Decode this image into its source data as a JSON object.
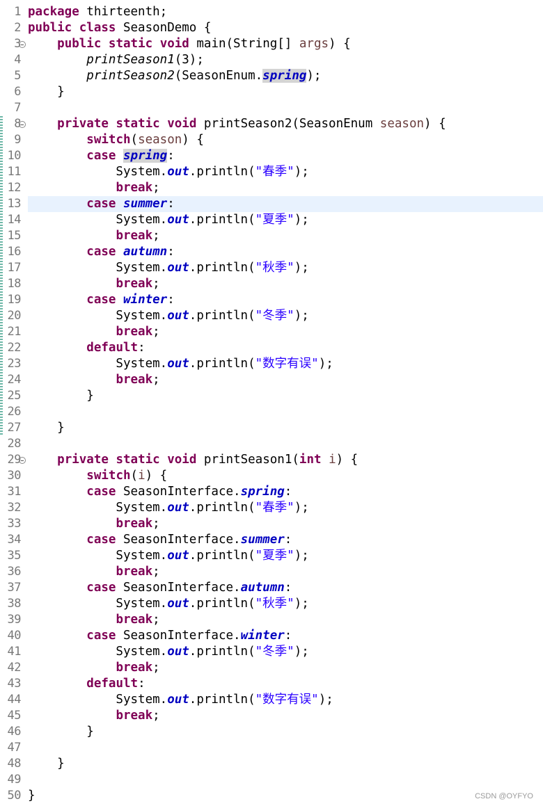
{
  "editor": {
    "current_line": 13,
    "fold_markers": [
      3,
      8,
      29
    ],
    "changed_line_ranges": [
      [
        8,
        27
      ]
    ],
    "colors": {
      "keyword": "#7f0055",
      "string": "#2a00ff",
      "field": "#0000c0",
      "local_variable": "#6a3e3e",
      "current_line_bg": "#e8f2fe",
      "occurrence_highlight": "#d4d4d4"
    },
    "lines": [
      {
        "n": "1",
        "tokens": [
          {
            "t": "package",
            "c": "kw"
          },
          {
            "t": " thirteenth;",
            "c": "plain"
          }
        ]
      },
      {
        "n": "2",
        "tokens": [
          {
            "t": "public",
            "c": "kw"
          },
          {
            "t": " ",
            "c": "plain"
          },
          {
            "t": "class",
            "c": "kw"
          },
          {
            "t": " SeasonDemo {",
            "c": "plain"
          }
        ]
      },
      {
        "n": "3",
        "tokens": [
          {
            "t": "    ",
            "c": "plain"
          },
          {
            "t": "public",
            "c": "kw"
          },
          {
            "t": " ",
            "c": "plain"
          },
          {
            "t": "static",
            "c": "kw"
          },
          {
            "t": " ",
            "c": "plain"
          },
          {
            "t": "void",
            "c": "kw"
          },
          {
            "t": " main(String[] ",
            "c": "plain"
          },
          {
            "t": "args",
            "c": "var"
          },
          {
            "t": ") {",
            "c": "plain"
          }
        ]
      },
      {
        "n": "4",
        "tokens": [
          {
            "t": "        ",
            "c": "plain"
          },
          {
            "t": "printSeason1",
            "c": "mcall"
          },
          {
            "t": "(3);",
            "c": "plain"
          }
        ]
      },
      {
        "n": "5",
        "tokens": [
          {
            "t": "        ",
            "c": "plain"
          },
          {
            "t": "printSeason2",
            "c": "mcall"
          },
          {
            "t": "(SeasonEnum.",
            "c": "plain"
          },
          {
            "t": "spring",
            "c": "fld hl"
          },
          {
            "t": ");",
            "c": "plain"
          }
        ]
      },
      {
        "n": "6",
        "tokens": [
          {
            "t": "    }",
            "c": "plain"
          }
        ]
      },
      {
        "n": "7",
        "tokens": []
      },
      {
        "n": "8",
        "tokens": [
          {
            "t": "    ",
            "c": "plain"
          },
          {
            "t": "private",
            "c": "kw"
          },
          {
            "t": " ",
            "c": "plain"
          },
          {
            "t": "static",
            "c": "kw"
          },
          {
            "t": " ",
            "c": "plain"
          },
          {
            "t": "void",
            "c": "kw"
          },
          {
            "t": " printSeason2(SeasonEnum ",
            "c": "plain"
          },
          {
            "t": "season",
            "c": "var"
          },
          {
            "t": ") {",
            "c": "plain"
          }
        ]
      },
      {
        "n": "9",
        "tokens": [
          {
            "t": "        ",
            "c": "plain"
          },
          {
            "t": "switch",
            "c": "kw"
          },
          {
            "t": "(",
            "c": "plain"
          },
          {
            "t": "season",
            "c": "var"
          },
          {
            "t": ") {",
            "c": "plain"
          }
        ]
      },
      {
        "n": "10",
        "tokens": [
          {
            "t": "        ",
            "c": "plain"
          },
          {
            "t": "case",
            "c": "kw"
          },
          {
            "t": " ",
            "c": "plain"
          },
          {
            "t": "spring",
            "c": "fld hl"
          },
          {
            "t": ":",
            "c": "plain"
          }
        ]
      },
      {
        "n": "11",
        "tokens": [
          {
            "t": "            System.",
            "c": "plain"
          },
          {
            "t": "out",
            "c": "fld"
          },
          {
            "t": ".println(",
            "c": "plain"
          },
          {
            "t": "\"春季\"",
            "c": "str"
          },
          {
            "t": ");",
            "c": "plain"
          }
        ]
      },
      {
        "n": "12",
        "tokens": [
          {
            "t": "            ",
            "c": "plain"
          },
          {
            "t": "break",
            "c": "kw"
          },
          {
            "t": ";",
            "c": "plain"
          }
        ]
      },
      {
        "n": "13",
        "tokens": [
          {
            "t": "        ",
            "c": "plain"
          },
          {
            "t": "case",
            "c": "kw"
          },
          {
            "t": " ",
            "c": "plain"
          },
          {
            "t": "summer",
            "c": "fld"
          },
          {
            "t": ":",
            "c": "plain"
          }
        ]
      },
      {
        "n": "14",
        "tokens": [
          {
            "t": "            System.",
            "c": "plain"
          },
          {
            "t": "out",
            "c": "fld"
          },
          {
            "t": ".println(",
            "c": "plain"
          },
          {
            "t": "\"夏季\"",
            "c": "str"
          },
          {
            "t": ");",
            "c": "plain"
          }
        ]
      },
      {
        "n": "15",
        "tokens": [
          {
            "t": "            ",
            "c": "plain"
          },
          {
            "t": "break",
            "c": "kw"
          },
          {
            "t": ";",
            "c": "plain"
          }
        ]
      },
      {
        "n": "16",
        "tokens": [
          {
            "t": "        ",
            "c": "plain"
          },
          {
            "t": "case",
            "c": "kw"
          },
          {
            "t": " ",
            "c": "plain"
          },
          {
            "t": "autumn",
            "c": "fld"
          },
          {
            "t": ":",
            "c": "plain"
          }
        ]
      },
      {
        "n": "17",
        "tokens": [
          {
            "t": "            System.",
            "c": "plain"
          },
          {
            "t": "out",
            "c": "fld"
          },
          {
            "t": ".println(",
            "c": "plain"
          },
          {
            "t": "\"秋季\"",
            "c": "str"
          },
          {
            "t": ");",
            "c": "plain"
          }
        ]
      },
      {
        "n": "18",
        "tokens": [
          {
            "t": "            ",
            "c": "plain"
          },
          {
            "t": "break",
            "c": "kw"
          },
          {
            "t": ";",
            "c": "plain"
          }
        ]
      },
      {
        "n": "19",
        "tokens": [
          {
            "t": "        ",
            "c": "plain"
          },
          {
            "t": "case",
            "c": "kw"
          },
          {
            "t": " ",
            "c": "plain"
          },
          {
            "t": "winter",
            "c": "fld"
          },
          {
            "t": ":",
            "c": "plain"
          }
        ]
      },
      {
        "n": "20",
        "tokens": [
          {
            "t": "            System.",
            "c": "plain"
          },
          {
            "t": "out",
            "c": "fld"
          },
          {
            "t": ".println(",
            "c": "plain"
          },
          {
            "t": "\"冬季\"",
            "c": "str"
          },
          {
            "t": ");",
            "c": "plain"
          }
        ]
      },
      {
        "n": "21",
        "tokens": [
          {
            "t": "            ",
            "c": "plain"
          },
          {
            "t": "break",
            "c": "kw"
          },
          {
            "t": ";",
            "c": "plain"
          }
        ]
      },
      {
        "n": "22",
        "tokens": [
          {
            "t": "        ",
            "c": "plain"
          },
          {
            "t": "default",
            "c": "kw"
          },
          {
            "t": ":",
            "c": "plain"
          }
        ]
      },
      {
        "n": "23",
        "tokens": [
          {
            "t": "            System.",
            "c": "plain"
          },
          {
            "t": "out",
            "c": "fld"
          },
          {
            "t": ".println(",
            "c": "plain"
          },
          {
            "t": "\"数字有误\"",
            "c": "str"
          },
          {
            "t": ");",
            "c": "plain"
          }
        ]
      },
      {
        "n": "24",
        "tokens": [
          {
            "t": "            ",
            "c": "plain"
          },
          {
            "t": "break",
            "c": "kw"
          },
          {
            "t": ";",
            "c": "plain"
          }
        ]
      },
      {
        "n": "25",
        "tokens": [
          {
            "t": "        }",
            "c": "plain"
          }
        ]
      },
      {
        "n": "26",
        "tokens": []
      },
      {
        "n": "27",
        "tokens": [
          {
            "t": "    }",
            "c": "plain"
          }
        ]
      },
      {
        "n": "28",
        "tokens": []
      },
      {
        "n": "29",
        "tokens": [
          {
            "t": "    ",
            "c": "plain"
          },
          {
            "t": "private",
            "c": "kw"
          },
          {
            "t": " ",
            "c": "plain"
          },
          {
            "t": "static",
            "c": "kw"
          },
          {
            "t": " ",
            "c": "plain"
          },
          {
            "t": "void",
            "c": "kw"
          },
          {
            "t": " printSeason1(",
            "c": "plain"
          },
          {
            "t": "int",
            "c": "kw"
          },
          {
            "t": " ",
            "c": "plain"
          },
          {
            "t": "i",
            "c": "var"
          },
          {
            "t": ") {",
            "c": "plain"
          }
        ]
      },
      {
        "n": "30",
        "tokens": [
          {
            "t": "        ",
            "c": "plain"
          },
          {
            "t": "switch",
            "c": "kw"
          },
          {
            "t": "(",
            "c": "plain"
          },
          {
            "t": "i",
            "c": "var"
          },
          {
            "t": ") {",
            "c": "plain"
          }
        ]
      },
      {
        "n": "31",
        "tokens": [
          {
            "t": "        ",
            "c": "plain"
          },
          {
            "t": "case",
            "c": "kw"
          },
          {
            "t": " SeasonInterface.",
            "c": "plain"
          },
          {
            "t": "spring",
            "c": "fld"
          },
          {
            "t": ":",
            "c": "plain"
          }
        ]
      },
      {
        "n": "32",
        "tokens": [
          {
            "t": "            System.",
            "c": "plain"
          },
          {
            "t": "out",
            "c": "fld"
          },
          {
            "t": ".println(",
            "c": "plain"
          },
          {
            "t": "\"春季\"",
            "c": "str"
          },
          {
            "t": ");",
            "c": "plain"
          }
        ]
      },
      {
        "n": "33",
        "tokens": [
          {
            "t": "            ",
            "c": "plain"
          },
          {
            "t": "break",
            "c": "kw"
          },
          {
            "t": ";",
            "c": "plain"
          }
        ]
      },
      {
        "n": "34",
        "tokens": [
          {
            "t": "        ",
            "c": "plain"
          },
          {
            "t": "case",
            "c": "kw"
          },
          {
            "t": " SeasonInterface.",
            "c": "plain"
          },
          {
            "t": "summer",
            "c": "fld"
          },
          {
            "t": ":",
            "c": "plain"
          }
        ]
      },
      {
        "n": "35",
        "tokens": [
          {
            "t": "            System.",
            "c": "plain"
          },
          {
            "t": "out",
            "c": "fld"
          },
          {
            "t": ".println(",
            "c": "plain"
          },
          {
            "t": "\"夏季\"",
            "c": "str"
          },
          {
            "t": ");",
            "c": "plain"
          }
        ]
      },
      {
        "n": "36",
        "tokens": [
          {
            "t": "            ",
            "c": "plain"
          },
          {
            "t": "break",
            "c": "kw"
          },
          {
            "t": ";",
            "c": "plain"
          }
        ]
      },
      {
        "n": "37",
        "tokens": [
          {
            "t": "        ",
            "c": "plain"
          },
          {
            "t": "case",
            "c": "kw"
          },
          {
            "t": " SeasonInterface.",
            "c": "plain"
          },
          {
            "t": "autumn",
            "c": "fld"
          },
          {
            "t": ":",
            "c": "plain"
          }
        ]
      },
      {
        "n": "38",
        "tokens": [
          {
            "t": "            System.",
            "c": "plain"
          },
          {
            "t": "out",
            "c": "fld"
          },
          {
            "t": ".println(",
            "c": "plain"
          },
          {
            "t": "\"秋季\"",
            "c": "str"
          },
          {
            "t": ");",
            "c": "plain"
          }
        ]
      },
      {
        "n": "39",
        "tokens": [
          {
            "t": "            ",
            "c": "plain"
          },
          {
            "t": "break",
            "c": "kw"
          },
          {
            "t": ";",
            "c": "plain"
          }
        ]
      },
      {
        "n": "40",
        "tokens": [
          {
            "t": "        ",
            "c": "plain"
          },
          {
            "t": "case",
            "c": "kw"
          },
          {
            "t": " SeasonInterface.",
            "c": "plain"
          },
          {
            "t": "winter",
            "c": "fld"
          },
          {
            "t": ":",
            "c": "plain"
          }
        ]
      },
      {
        "n": "41",
        "tokens": [
          {
            "t": "            System.",
            "c": "plain"
          },
          {
            "t": "out",
            "c": "fld"
          },
          {
            "t": ".println(",
            "c": "plain"
          },
          {
            "t": "\"冬季\"",
            "c": "str"
          },
          {
            "t": ");",
            "c": "plain"
          }
        ]
      },
      {
        "n": "42",
        "tokens": [
          {
            "t": "            ",
            "c": "plain"
          },
          {
            "t": "break",
            "c": "kw"
          },
          {
            "t": ";",
            "c": "plain"
          }
        ]
      },
      {
        "n": "43",
        "tokens": [
          {
            "t": "        ",
            "c": "plain"
          },
          {
            "t": "default",
            "c": "kw"
          },
          {
            "t": ":",
            "c": "plain"
          }
        ]
      },
      {
        "n": "44",
        "tokens": [
          {
            "t": "            System.",
            "c": "plain"
          },
          {
            "t": "out",
            "c": "fld"
          },
          {
            "t": ".println(",
            "c": "plain"
          },
          {
            "t": "\"数字有误\"",
            "c": "str"
          },
          {
            "t": ");",
            "c": "plain"
          }
        ]
      },
      {
        "n": "45",
        "tokens": [
          {
            "t": "            ",
            "c": "plain"
          },
          {
            "t": "break",
            "c": "kw"
          },
          {
            "t": ";",
            "c": "plain"
          }
        ]
      },
      {
        "n": "46",
        "tokens": [
          {
            "t": "        }",
            "c": "plain"
          }
        ]
      },
      {
        "n": "47",
        "tokens": []
      },
      {
        "n": "48",
        "tokens": [
          {
            "t": "    }",
            "c": "plain"
          }
        ]
      },
      {
        "n": "49",
        "tokens": []
      },
      {
        "n": "50",
        "tokens": [
          {
            "t": "}",
            "c": "plain"
          }
        ]
      }
    ]
  },
  "watermark": "CSDN @OYFYO"
}
